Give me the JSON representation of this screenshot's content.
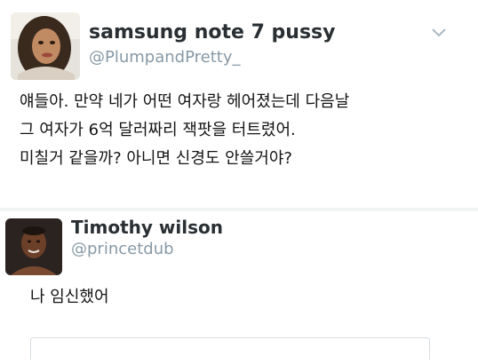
{
  "tweet1": {
    "display_name": "samsung note 7 pussy",
    "handle": "@PlumpandPretty_",
    "menu_icon": "chevron-down-icon",
    "body_lines": [
      "얘들아. 만약 네가 어떤 여자랑 헤어졌는데 다음날",
      "그 여자가 6억 달러짜리 잭팟을 터트렸어.",
      "미칠거 같을까? 아니면 신경도 안쓸거야?"
    ]
  },
  "tweet2": {
    "display_name": "Timothy wilson",
    "handle": "@princetdub",
    "body": "나 임신했어"
  },
  "colors": {
    "name": "#292f33",
    "handle": "#8899a6",
    "text": "#141414",
    "divider": "#f2f4f5"
  }
}
